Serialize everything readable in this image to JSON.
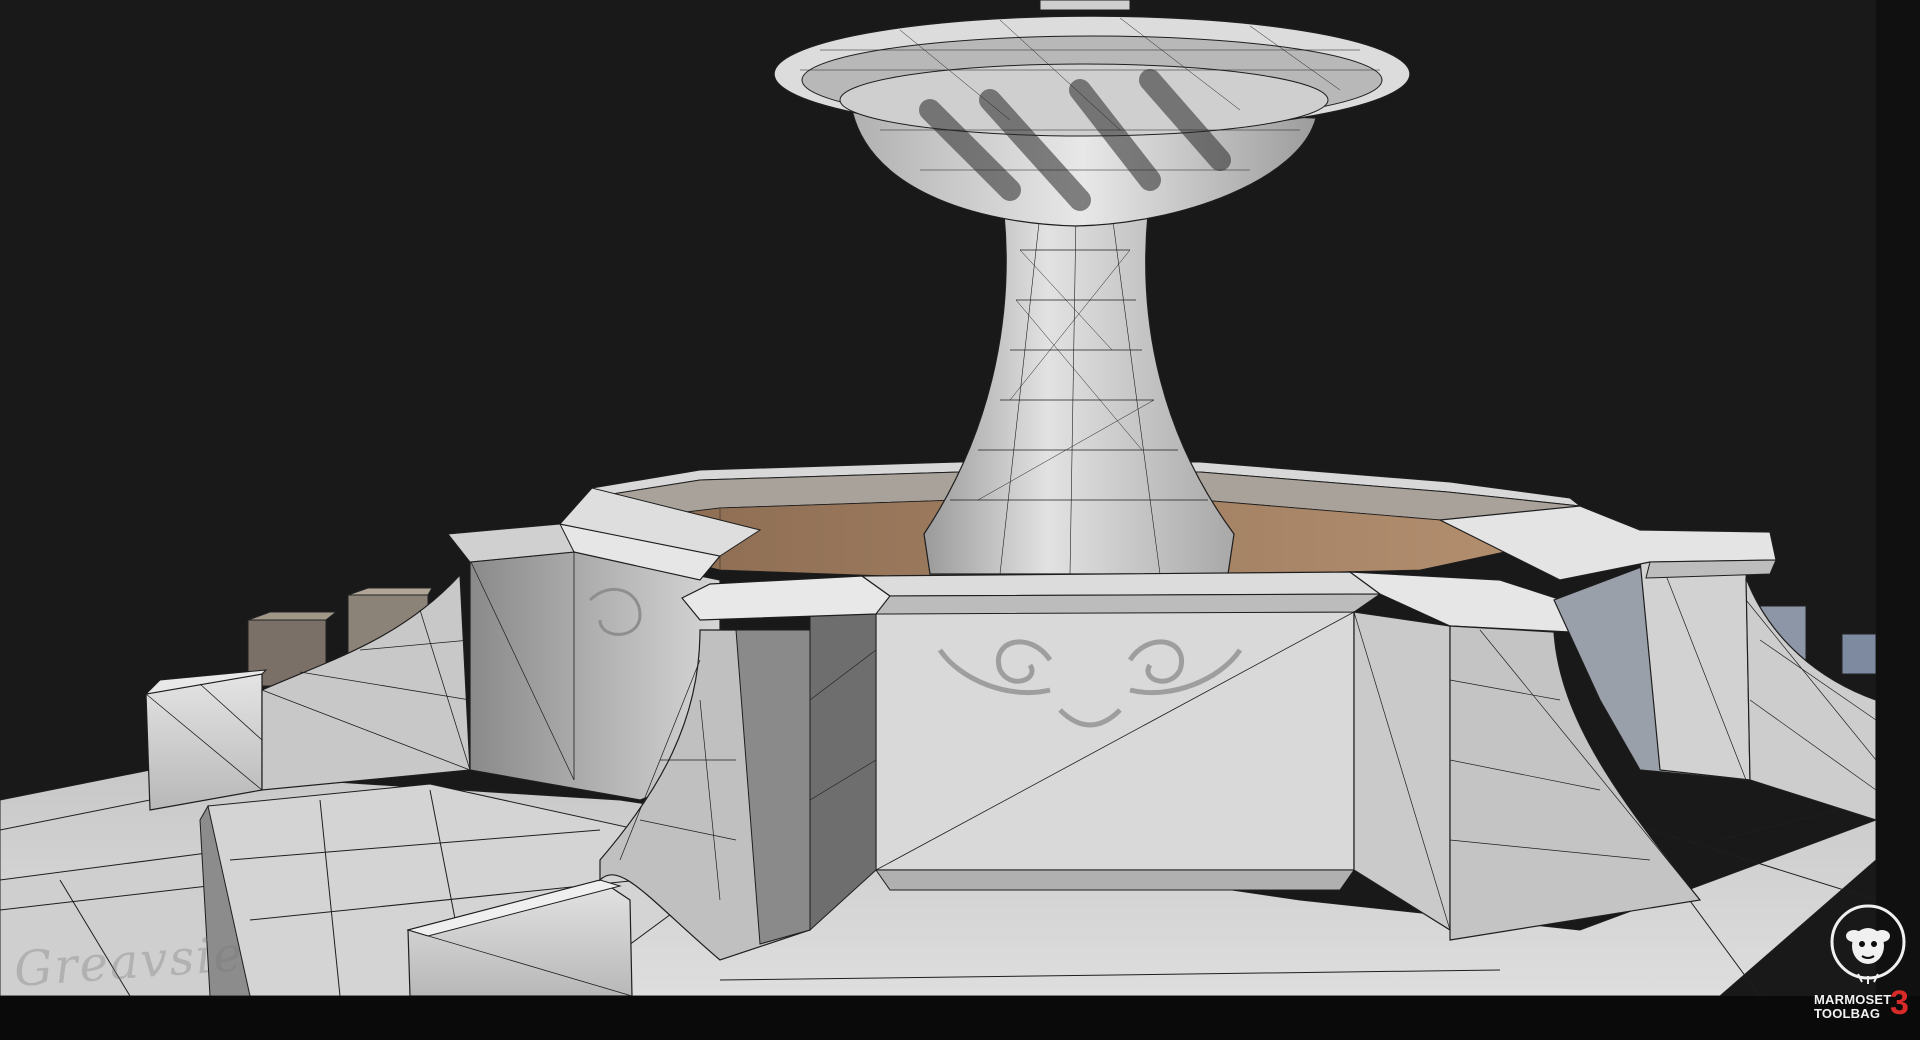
{
  "viewport": {
    "background_color": "#191919",
    "frame_color": "#0c0c0c",
    "render_mode": "textured-with-wireframe",
    "subject": "stone-fountain-3d-model"
  },
  "watermark": {
    "icon": "marmoset-monkey-icon",
    "line1": "MARMOSET",
    "line2": "TOOLBAG",
    "version": "3",
    "version_color": "#d92a2a"
  },
  "signature": {
    "text": "Greavsie"
  },
  "colors": {
    "stone_light": "#dcdcdc",
    "stone_mid": "#b4b4b4",
    "stone_dark": "#6a6a6a",
    "water": "#a0826a",
    "wire": "#1e1e1e"
  }
}
